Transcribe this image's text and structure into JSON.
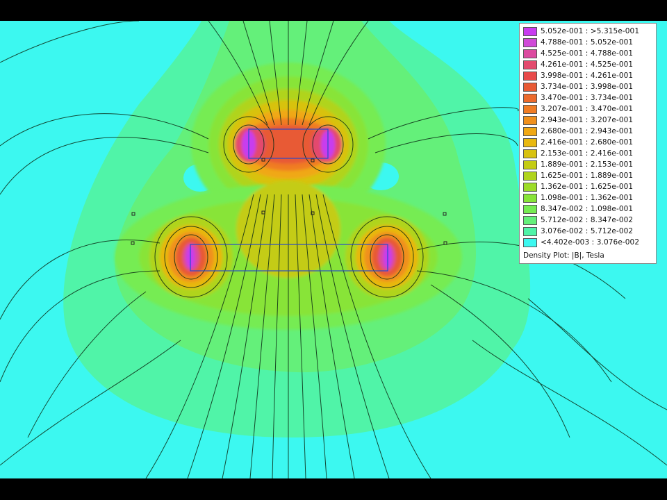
{
  "legend": {
    "caption": "Density Plot: |B|, Tesla",
    "ranges": [
      {
        "label": "5.052e-001 : >5.315e-001",
        "color": "#c83cf0"
      },
      {
        "label": "4.788e-001 : 5.052e-001",
        "color": "#d04ad8"
      },
      {
        "label": "4.525e-001 : 4.788e-001",
        "color": "#dc4aa0"
      },
      {
        "label": "4.261e-001 : 4.525e-001",
        "color": "#e34a6e"
      },
      {
        "label": "3.998e-001 : 4.261e-001",
        "color": "#e84a4a"
      },
      {
        "label": "3.734e-001 : 3.998e-001",
        "color": "#e85a34"
      },
      {
        "label": "3.470e-001 : 3.734e-001",
        "color": "#ec6a2c"
      },
      {
        "label": "3.207e-001 : 3.470e-001",
        "color": "#f07c24"
      },
      {
        "label": "2.943e-001 : 3.207e-001",
        "color": "#f0901c"
      },
      {
        "label": "2.680e-001 : 2.943e-001",
        "color": "#f0a814"
      },
      {
        "label": "2.416e-001 : 2.680e-001",
        "color": "#e8b810"
      },
      {
        "label": "2.153e-001 : 2.416e-001",
        "color": "#d8c210"
      },
      {
        "label": "1.889e-001 : 2.153e-001",
        "color": "#c4cc14"
      },
      {
        "label": "1.625e-001 : 1.889e-001",
        "color": "#b0d41c"
      },
      {
        "label": "1.362e-001 : 1.625e-001",
        "color": "#9cdc28"
      },
      {
        "label": "1.098e-001 : 1.362e-001",
        "color": "#88e438"
      },
      {
        "label": "8.347e-002 : 1.098e-001",
        "color": "#76ec52"
      },
      {
        "label": "5.712e-002 : 8.347e-002",
        "color": "#64f07a"
      },
      {
        "label": "3.076e-002 : 5.712e-002",
        "color": "#50f4a8"
      },
      {
        "label": "<4.402e-003 : 3.076e-002",
        "color": "#3cf8f0"
      }
    ]
  },
  "colors": {
    "background_field": "#3cf8f0",
    "contour_line": "#0a2a14",
    "conductor_outline": "#2a4ac8"
  }
}
